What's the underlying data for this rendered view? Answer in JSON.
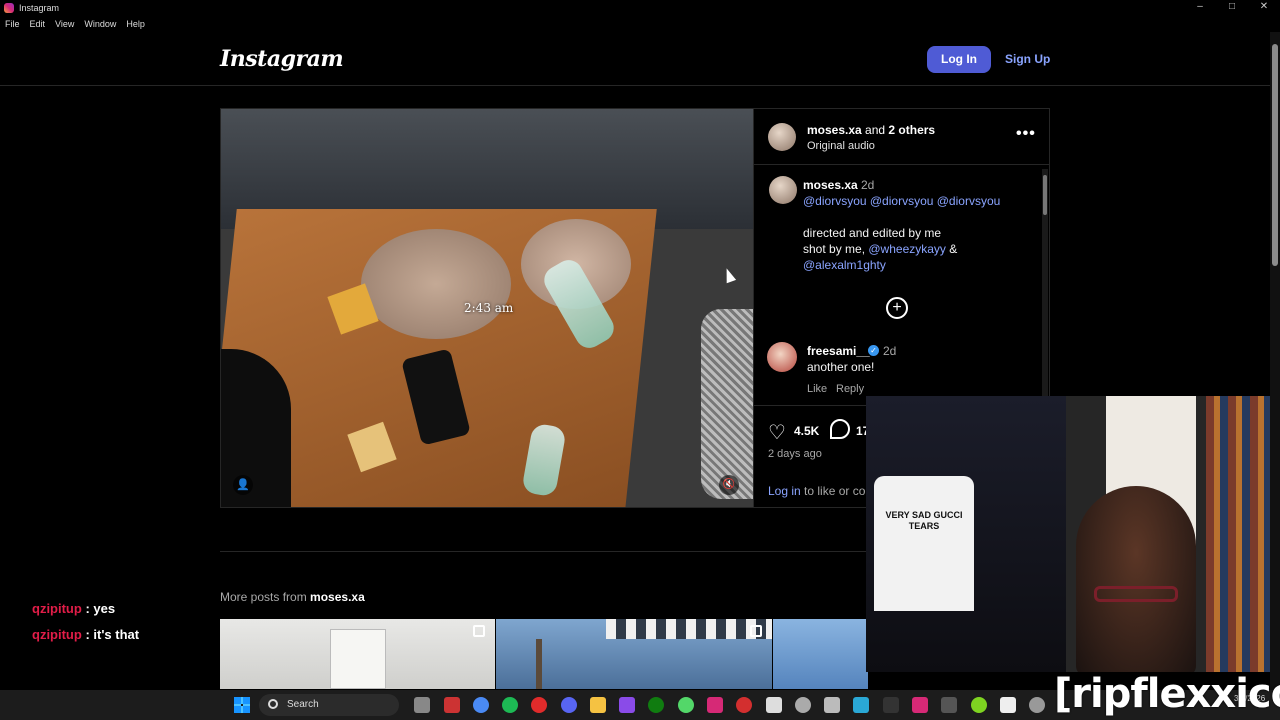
{
  "window": {
    "title": "Instagram",
    "controls": [
      "–",
      "□",
      "✕"
    ]
  },
  "menu": [
    "File",
    "Edit",
    "View",
    "Window",
    "Help"
  ],
  "header": {
    "logo": "Instagram",
    "login": "Log In",
    "signup": "Sign Up"
  },
  "post": {
    "overlay_time": "2:43 am",
    "head_user": "moses.xa",
    "head_and": "and",
    "head_others": "2 others",
    "audio": "Original audio",
    "caption": {
      "user": "moses.xa",
      "time": "2d",
      "mentions": "@diorvsyou @diorvsyou @diorvsyou",
      "line1": "directed and edited by me",
      "line2_prefix": "shot by me,",
      "line2_mention": "@wheezykayy",
      "line2_suffix": "&",
      "line3_mention": "@alexalm1ghty"
    },
    "comment": {
      "user": "freesami__",
      "time": "2d",
      "text": "another one!",
      "like": "Like",
      "reply": "Reply"
    },
    "likes": "4.5K",
    "comments": "17",
    "posted": "2 days ago",
    "login_link": "Log in",
    "login_note": "to like or co"
  },
  "more_posts": {
    "label": "More posts from",
    "user": "moses.xa"
  },
  "chat": [
    {
      "user": "qzipitup",
      "message": "yes"
    },
    {
      "user": "qzipitup",
      "message": "it's that"
    }
  ],
  "webcam": {
    "shirt_text": "VERY SAD GUCCI TEARS"
  },
  "watermark": "[ripflexxico]",
  "taskbar": {
    "search": "Search",
    "date": "3/1/2026"
  },
  "colors": {
    "accent": "#4f5bd5",
    "link": "#8aa4ff",
    "chat_user": "#e11d48"
  }
}
